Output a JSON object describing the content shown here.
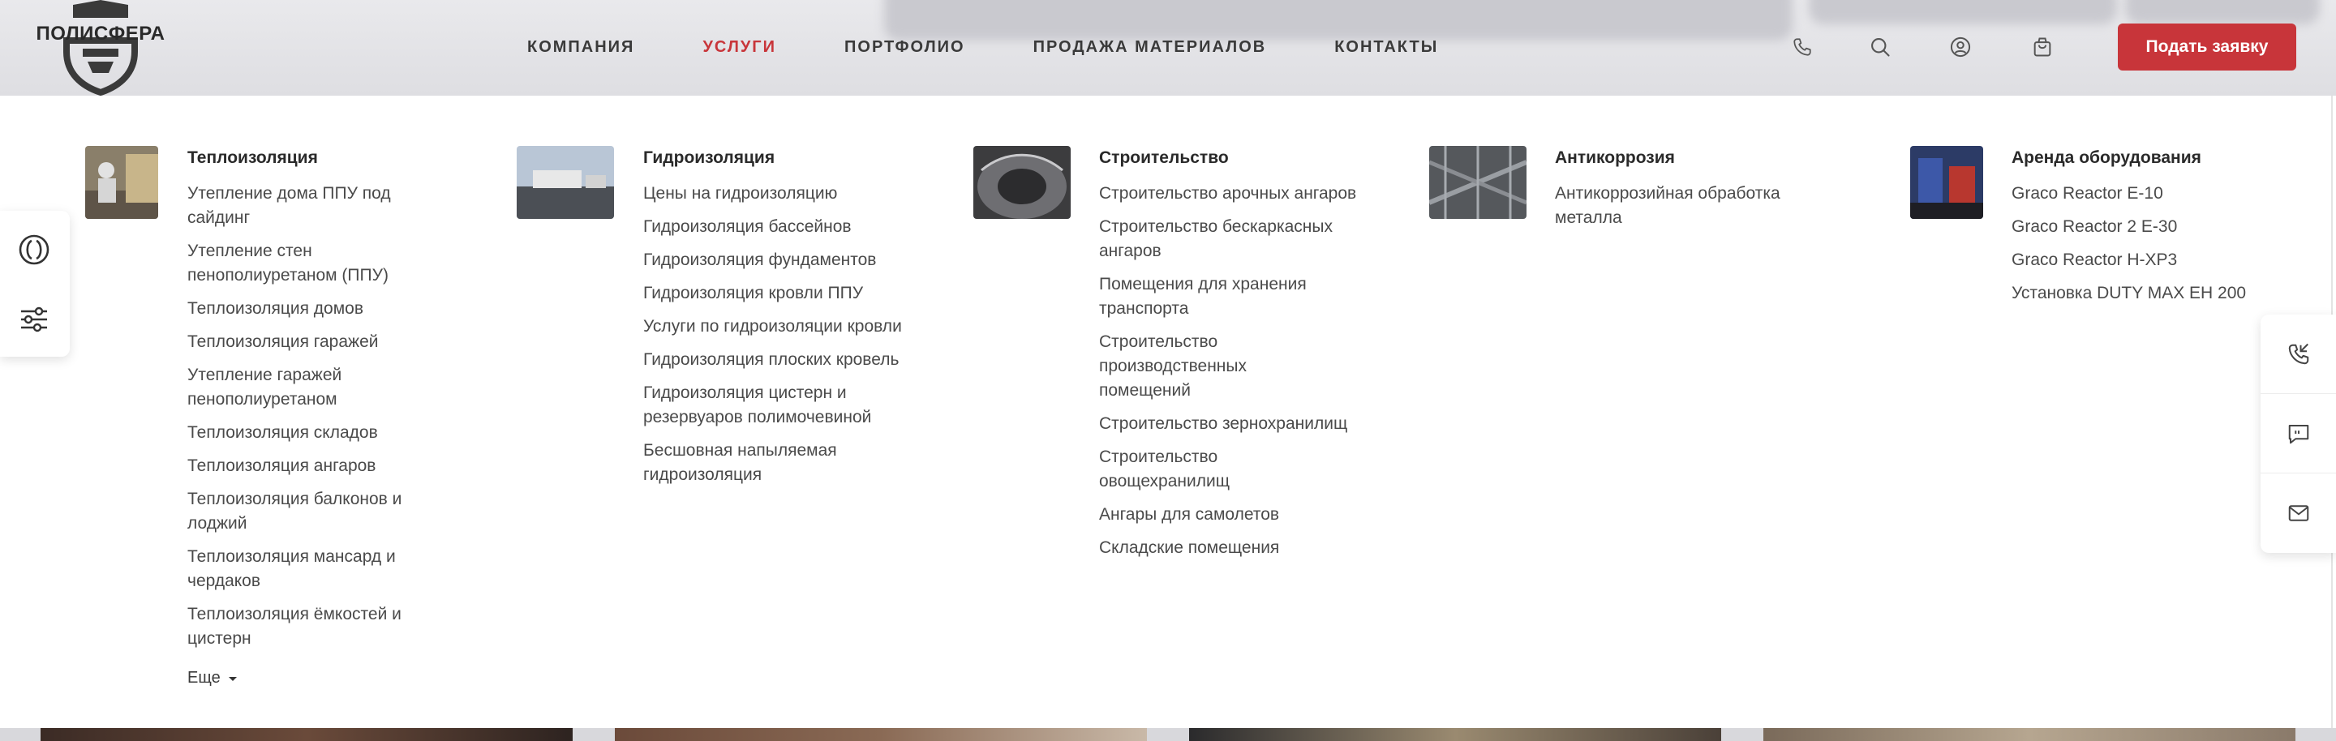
{
  "header": {
    "logo_text": "ПОЛИСФЕРА",
    "nav": [
      {
        "label": "КОМПАНИЯ",
        "active": false
      },
      {
        "label": "УСЛУГИ",
        "active": true
      },
      {
        "label": "ПОРТФОЛИО",
        "active": false
      },
      {
        "label": "ПРОДАЖА МАТЕРИАЛОВ",
        "active": false
      },
      {
        "label": "КОНТАКТЫ",
        "active": false
      }
    ],
    "icons": [
      "phone-icon",
      "search-icon",
      "user-icon",
      "cart-icon"
    ],
    "cta_label": "Подать заявку"
  },
  "menu": {
    "columns": [
      {
        "title": "Теплоизоляция",
        "links": [
          "Утепление дома ППУ под сайдинг",
          "Утепление стен пенополиуретаном (ППУ)",
          "Теплоизоляция домов",
          "Теплоизоляция гаражей",
          "Утепление гаражей пенополиуретаном",
          "Теплоизоляция складов",
          "Теплоизоляция ангаров",
          "Теплоизоляция балконов и лоджий",
          "Теплоизоляция мансард и чердаков",
          "Теплоизоляция ёмкостей и цистерн"
        ],
        "more_label": "Еще"
      },
      {
        "title": "Гидроизоляция",
        "links": [
          "Цены на гидроизоляцию",
          "Гидроизоляция бассейнов",
          "Гидроизоляция фундаментов",
          "Гидроизоляция кровли ППУ",
          "Услуги по гидроизоляции кровли",
          "Гидроизоляция плоских кровель",
          "Гидроизоляция цистерн и резервуаров полимочевиной",
          "Бесшовная напыляемая гидроизоляция"
        ]
      },
      {
        "title": "Строительство",
        "links": [
          "Строительство арочных ангаров",
          "Строительство бескаркасных ангаров",
          "Помещения для хранения транспорта",
          "Строительство производственных помещений",
          "Строительство зернохранилищ",
          "Строительство овощехранилищ",
          "Ангары для самолетов",
          "Складские помещения"
        ]
      },
      {
        "title": "Антикоррозия",
        "links": [
          "Антикоррозийная обработка металла"
        ]
      },
      {
        "title": "Аренда оборудования",
        "links": [
          "Graco Reactor E-10",
          "Graco Reactor 2 E-30",
          "Graco Reactor H-XP3",
          "Установка DUTY MAX EH 200"
        ]
      }
    ]
  },
  "left_widget_icons": [
    "circle-logo-icon",
    "filter-sliders-icon"
  ],
  "right_widget_icons": [
    "callback-phone-icon",
    "chat-icon",
    "mail-icon"
  ],
  "colors": {
    "accent": "#c8353a",
    "text": "#3a3a3a",
    "panel": "#ffffff"
  }
}
